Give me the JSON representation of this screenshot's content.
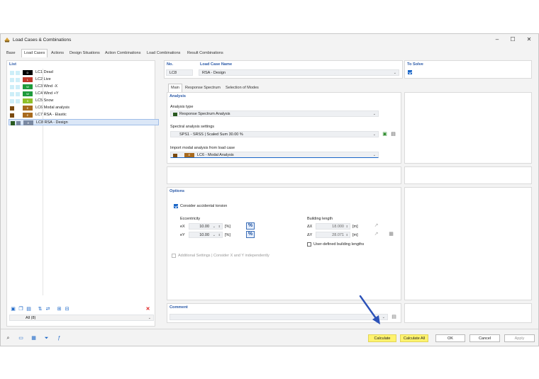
{
  "window": {
    "title": "Load Cases & Combinations"
  },
  "tabs": [
    {
      "label": "Base"
    },
    {
      "label": "Load Cases"
    },
    {
      "label": "Actions"
    },
    {
      "label": "Design Situations"
    },
    {
      "label": "Action Combinations"
    },
    {
      "label": "Load Combinations"
    },
    {
      "label": "Result Combinations"
    }
  ],
  "list": {
    "header": "List",
    "items": [
      {
        "code": "D",
        "label": "LC1 Dead",
        "color": "#000000"
      },
      {
        "code": "L",
        "label": "LC2 Live",
        "color": "#c0392b"
      },
      {
        "code": "W",
        "label": "LC3 Wind -X",
        "color": "#1f9b3c"
      },
      {
        "code": "W",
        "label": "LC4 Wind +Y",
        "color": "#1f9b3c"
      },
      {
        "code": "S",
        "label": "LC5 Snow",
        "color": "#8fbf2a"
      },
      {
        "code": "E",
        "label": "LC6 Modal analysis",
        "color": "#7a4a10"
      },
      {
        "code": "E",
        "label": "LC7 RSA - Elastic",
        "color": "#7a4a10"
      },
      {
        "code": "E",
        "label": "LC8 RSA - Design",
        "color": "#7a4a10"
      }
    ],
    "filter_value": "All (8)"
  },
  "header": {
    "no_label": "No.",
    "no_value": "LC8",
    "name_label": "Load Case Name",
    "name_value": "RSA - Design",
    "solve_label": "To Solve"
  },
  "subtabs": [
    {
      "label": "Main"
    },
    {
      "label": "Response Spectrum"
    },
    {
      "label": "Selection of Modes"
    }
  ],
  "analysis": {
    "header": "Analysis",
    "type_label": "Analysis type",
    "type_value": "Response Spectrum Analysis",
    "spectral_label": "Spectral analysis settings",
    "spectral_value": "SPS1 - SRSS | Scaled Sum 30.00 %",
    "import_label": "Import modal analysis from load case",
    "import_code": "E",
    "import_value": "LC6 - Modal Analysis"
  },
  "options": {
    "header": "Options",
    "torsion_label": "Consider accidental torsion",
    "ecc_label": "Eccentricity",
    "ex_label": "eX",
    "ex_value": "10.00",
    "ey_label": "eY",
    "ey_value": "10.00",
    "pct_unit": "[%]",
    "bl_label": "Building length",
    "lx_label": "ΔX",
    "lx_value": "18.000",
    "ly_label": "ΔY",
    "ly_value": "28.071",
    "m_unit": "[m]",
    "user_defined_label": "User-defined building lengths",
    "additional_label": "Additional Settings | Consider X and Y independently"
  },
  "comment": {
    "header": "Comment"
  },
  "buttons": {
    "calculate": "Calculate",
    "calculate_all": "Calculate All",
    "ok": "OK",
    "cancel": "Cancel",
    "apply": "Apply"
  },
  "colors": {
    "accent": "#1a66c7",
    "highlight": "#fff36e",
    "header_text": "#2b5aa8"
  }
}
